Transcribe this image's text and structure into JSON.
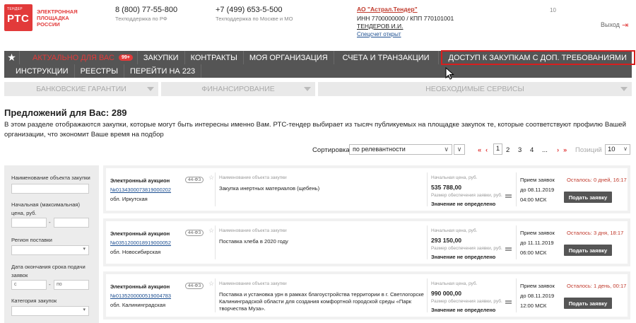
{
  "header": {
    "logo_small": "ТЕНДЕР",
    "logo_big": "РТС",
    "logo_text": "ЭЛЕКТРОННАЯ ПЛОЩАДКА РОССИИ",
    "phone1": "8 (800) 77-55-800",
    "phone1_caption": "Техподдержка по РФ",
    "phone2": "+7 (499) 653-5-500",
    "phone2_caption": "Техподдержка по Москве и МО",
    "org_name": "АО \"Астрал.Тендер\"",
    "org_inn": "ИНН 7700000000 / КПП 770101001",
    "org_user": "ТЕНДЕРОВ И.И.",
    "org_account": "Спецсчет открыт",
    "counter": "10",
    "exit_label": "Выход"
  },
  "nav": {
    "row1": [
      {
        "label": "АКТУАЛЬНО ДЛЯ ВАС",
        "badge": "99+"
      },
      {
        "label": "ЗАКУПКИ"
      },
      {
        "label": "КОНТРАКТЫ"
      },
      {
        "label": "МОЯ ОРГАНИЗАЦИЯ"
      },
      {
        "label": "СЧЕТА И ТРАНЗАКЦИИ"
      },
      {
        "label": "ДОСТУП К ЗАКУПКАМ С ДОП. ТРЕБОВАНИЯМИ"
      }
    ],
    "row2": [
      {
        "label": "ИНСТРУКЦИИ"
      },
      {
        "label": "РЕЕСТРЫ"
      },
      {
        "label": "ПЕРЕЙТИ НА 223"
      }
    ]
  },
  "subnav": [
    "БАНКОВСКИЕ ГАРАНТИИ",
    "ФИНАНСИРОВАНИЕ",
    "НЕОБХОДИМЫЕ СЕРВИСЫ"
  ],
  "main": {
    "title": "Предложений для Вас: 289",
    "description": "В этом разделе отображаются закупки, которые могут быть интересны именно Вам. РТС-тендер выбирает из тысяч публикуемых на площадке закупок те, которые соответствуют профилю Вашей организации, что экономит Ваше время на подбор"
  },
  "sort": {
    "label": "Сортировка:",
    "value": "по релевантности",
    "direction_icon": "∨"
  },
  "pagination": {
    "first": "«",
    "prev": "‹",
    "pages": [
      "1",
      "2",
      "3",
      "4"
    ],
    "ellipsis": "...",
    "next": "›",
    "last": "»",
    "current": "1",
    "positions_label": "Позиций",
    "positions_value": "10"
  },
  "filters": {
    "object_name_label": "Наименование объекта закупки",
    "price_label": "Начальная (максимальная) цена, руб.",
    "region_label": "Регион поставки",
    "deadline_label": "Окончания срока подачи заявок",
    "deadline_label_prefix": "Дата",
    "from_placeholder": "с",
    "to_placeholder": "по",
    "category_label": "Категория закупок",
    "dash": "-"
  },
  "cards": [
    {
      "type": "Электронный аукцион",
      "law": "44-ФЗ",
      "number": "№0134300073819000202",
      "region": "обл. Иркутская",
      "name_label": "Наименование объекта закупки",
      "name": "Закупка инертных материалов (щебень)",
      "price_label": "Начальная цена, руб.",
      "price": "535 788,00",
      "security_label": "Размер обеспечения заявки, руб.",
      "security_value": "Значение не определено",
      "apply_label": "Прием заявок",
      "apply_date": "до 08.11.2019",
      "apply_time": "04:00 МСК",
      "time_left": "Осталось: 0 дней, 16:17",
      "button": "Подать заявку"
    },
    {
      "type": "Электронный аукцион",
      "law": "44-ФЗ",
      "number": "№0351200018919000052",
      "region": "обл. Новосибирская",
      "name_label": "Наименование объекта закупки",
      "name": "Поставка хлеба в 2020 году",
      "price_label": "Начальная цена, руб.",
      "price": "293 150,00",
      "security_label": "Размер обеспечения заявки, руб.",
      "security_value": "Значение не определено",
      "apply_label": "Прием заявок",
      "apply_date": "до 11.11.2019",
      "apply_time": "06:00 МСК",
      "time_left": "Осталось: 3 дня, 18:17",
      "button": "Подать заявку"
    },
    {
      "type": "Электронный аукцион",
      "law": "44-ФЗ",
      "number": "№0135200000519004783",
      "region": "обл. Калининградская",
      "name_label": "Наименование объекта закупки",
      "name": "Поставка и установка урн в рамках благоустройства территории в г. Светлогорске Калининградской области для создания комфортной городской среды «Парк творчества Муза».",
      "price_label": "Начальная цена, руб.",
      "price": "990 000,00",
      "security_label": "Размер обеспечения заявки, руб.",
      "security_value": "Значение не определено",
      "apply_label": "Прием заявок",
      "apply_date": "до 08.11.2019",
      "apply_time": "12:00 МСК",
      "time_left": "Осталось: 1 день, 00:17",
      "button": "Подать заявку"
    }
  ],
  "icons": {
    "favorite": "star-icon",
    "exit": "exit-icon",
    "dropdown": "chevron-down-icon"
  },
  "colors": {
    "brand_red": "#e23a3a",
    "nav_bg": "#555555",
    "link_blue": "#1d4f91"
  }
}
